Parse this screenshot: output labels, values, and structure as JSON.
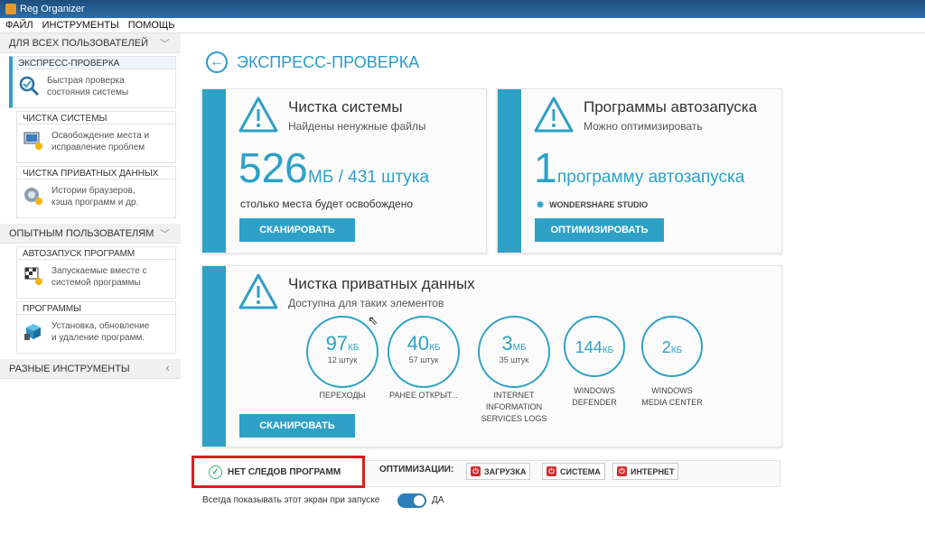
{
  "window": {
    "title": "Reg Organizer"
  },
  "menu": [
    "ФАЙЛ",
    "ИНСТРУМЕНТЫ",
    "ПОМОЩЬ"
  ],
  "sidebar": {
    "sections": [
      {
        "title": "ДЛЯ ВСЕХ ПОЛЬЗОВАТЕЛЕЙ",
        "chevron": "chevron-down-icon"
      },
      {
        "title": "ОПЫТНЫМ ПОЛЬЗОВАТЕЛЯМ",
        "chevron": "chevron-down-icon"
      },
      {
        "title": "РАЗНЫЕ ИНСТРУМЕНТЫ",
        "chevron": "chevron-left-icon"
      }
    ],
    "items": [
      {
        "title": "ЭКСПРЕСС-ПРОВЕРКА",
        "desc1": "Быстрая проверка",
        "desc2": "состояния системы",
        "icon": "magnifier-check-icon"
      },
      {
        "title": "ЧИСТКА СИСТЕМЫ",
        "desc1": "Освобождение места и",
        "desc2": "исправление проблем",
        "icon": "system-clean-icon"
      },
      {
        "title": "ЧИСТКА ПРИВАТНЫХ ДАННЫХ",
        "desc1": "Истории браузеров,",
        "desc2": "кэша программ и др.",
        "icon": "privacy-clean-icon"
      },
      {
        "title": "АВТОЗАПУСК ПРОГРАММ",
        "desc1": "Запускаемые вместе с",
        "desc2": "системой программы",
        "icon": "autorun-flag-icon"
      },
      {
        "title": "ПРОГРАММЫ",
        "desc1": "Установка, обновление",
        "desc2": "и удаление программ.",
        "icon": "programs-box-icon"
      }
    ]
  },
  "main": {
    "title": "ЭКСПРЕСС-ПРОВЕРКА",
    "system": {
      "title": "Чистка системы",
      "subtitle": "Найдены ненужные файлы",
      "value": "526",
      "unit": "МБ / 431 штука",
      "note": "столько места будет освобождено",
      "button": "СКАНИРОВАТЬ"
    },
    "autorun": {
      "title": "Программы автозапуска",
      "subtitle": "Можно оптимизировать",
      "value": "1",
      "unit": "программу автозапуска",
      "app": "WONDERSHARE STUDIO",
      "button": "ОПТИМИЗИРОВАТЬ"
    },
    "privacy": {
      "title": "Чистка приватных данных",
      "subtitle": "Доступна для таких элементов",
      "button": "СКАНИРОВАТЬ",
      "items": [
        {
          "value": "97",
          "unit": "КБ",
          "count": "12 штук",
          "label1": "ПЕРЕХОДЫ",
          "label2": "",
          "label3": ""
        },
        {
          "value": "40",
          "unit": "КБ",
          "count": "57 штук",
          "label1": "РАНЕЕ ОТКРЫТ...",
          "label2": "",
          "label3": ""
        },
        {
          "value": "3",
          "unit": "МБ",
          "count": "35 штук",
          "label1": "INTERNET",
          "label2": "INFORMATION",
          "label3": "SERVICES LOGS"
        },
        {
          "value": "144",
          "unit": "КБ",
          "count": "",
          "label1": "WINDOWS",
          "label2": "DEFENDER",
          "label3": ""
        },
        {
          "value": "2",
          "unit": "КБ",
          "count": "",
          "label1": "WINDOWS",
          "label2": "MEDIA CENTER",
          "label3": ""
        }
      ]
    },
    "no_traces": "НЕТ СЛЕДОВ ПРОГРАММ",
    "optimizations_label": "ОПТИМИЗАЦИИ:",
    "optimizations": [
      "ЗАГРУЗКА",
      "СИСТЕМА",
      "ИНТЕРНЕТ"
    ],
    "always_show": "Всегда показывать этот экран при запуске",
    "toggle_label": "ДА"
  },
  "colors": {
    "accent": "#2fa0c6",
    "highlight": "#d82020",
    "ok": "#3bb56b"
  }
}
